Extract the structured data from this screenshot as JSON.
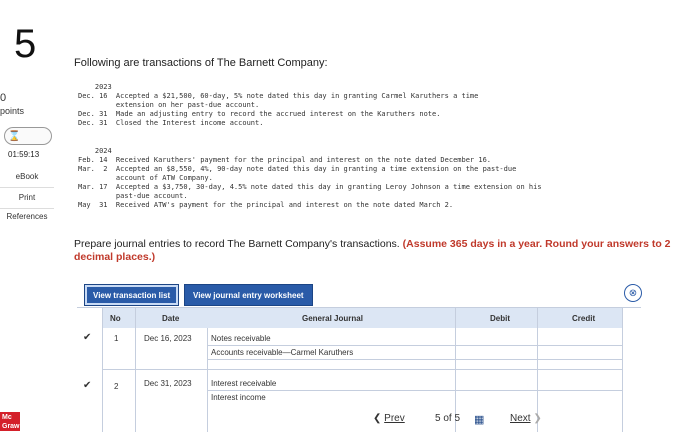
{
  "sidebar": {
    "question_number": "5",
    "points_value": "0",
    "points_label": "points",
    "timer": "01:59:13",
    "links": [
      "eBook",
      "Print",
      "References"
    ],
    "logo": "Mc\nGraw"
  },
  "question": {
    "intro": "Following are transactions of The Barnett Company:",
    "block2023": "    2023\nDec. 16  Accepted a $21,500, 60-day, 5% note dated this day in granting Carmel Karuthers a time\n         extension on her past-due account.\nDec. 31  Made an adjusting entry to record the accrued interest on the Karuthers note.\nDec. 31  Closed the Interest income account.",
    "block2024": "    2024\nFeb. 14  Received Karuthers' payment for the principal and interest on the note dated December 16.\nMar.  2  Accepted an $8,550, 4%, 90-day note dated this day in granting a time extension on the past-due\n         account of ATW Company.\nMar. 17  Accepted a $3,750, 30-day, 4.5% note dated this day in granting Leroy Johnson a time extension on his\n         past-due account.\nMay  31  Received ATW's payment for the principal and interest on the note dated March 2.",
    "prepare_text": "Prepare journal entries to record The Barnett Company's transactions.",
    "prepare_bold": "(Assume 365 days in a year. Round your answers to 2 decimal places.)"
  },
  "tabs": {
    "view_transaction_list": "View transaction list",
    "view_journal_worksheet": "View journal entry worksheet"
  },
  "journal": {
    "headers": {
      "no": "No",
      "date": "Date",
      "general_journal": "General Journal",
      "debit": "Debit",
      "credit": "Credit"
    },
    "rows": [
      {
        "no": "1",
        "date": "Dec 16, 2023",
        "accounts": [
          "Notes receivable",
          "Accounts receivable—Carmel Karuthers"
        ]
      },
      {
        "no": "2",
        "date": "Dec 31, 2023",
        "accounts": [
          "Interest receivable",
          "Interest income"
        ]
      }
    ]
  },
  "nav": {
    "prev": "Prev",
    "position": "5 of 5",
    "next": "Next"
  }
}
